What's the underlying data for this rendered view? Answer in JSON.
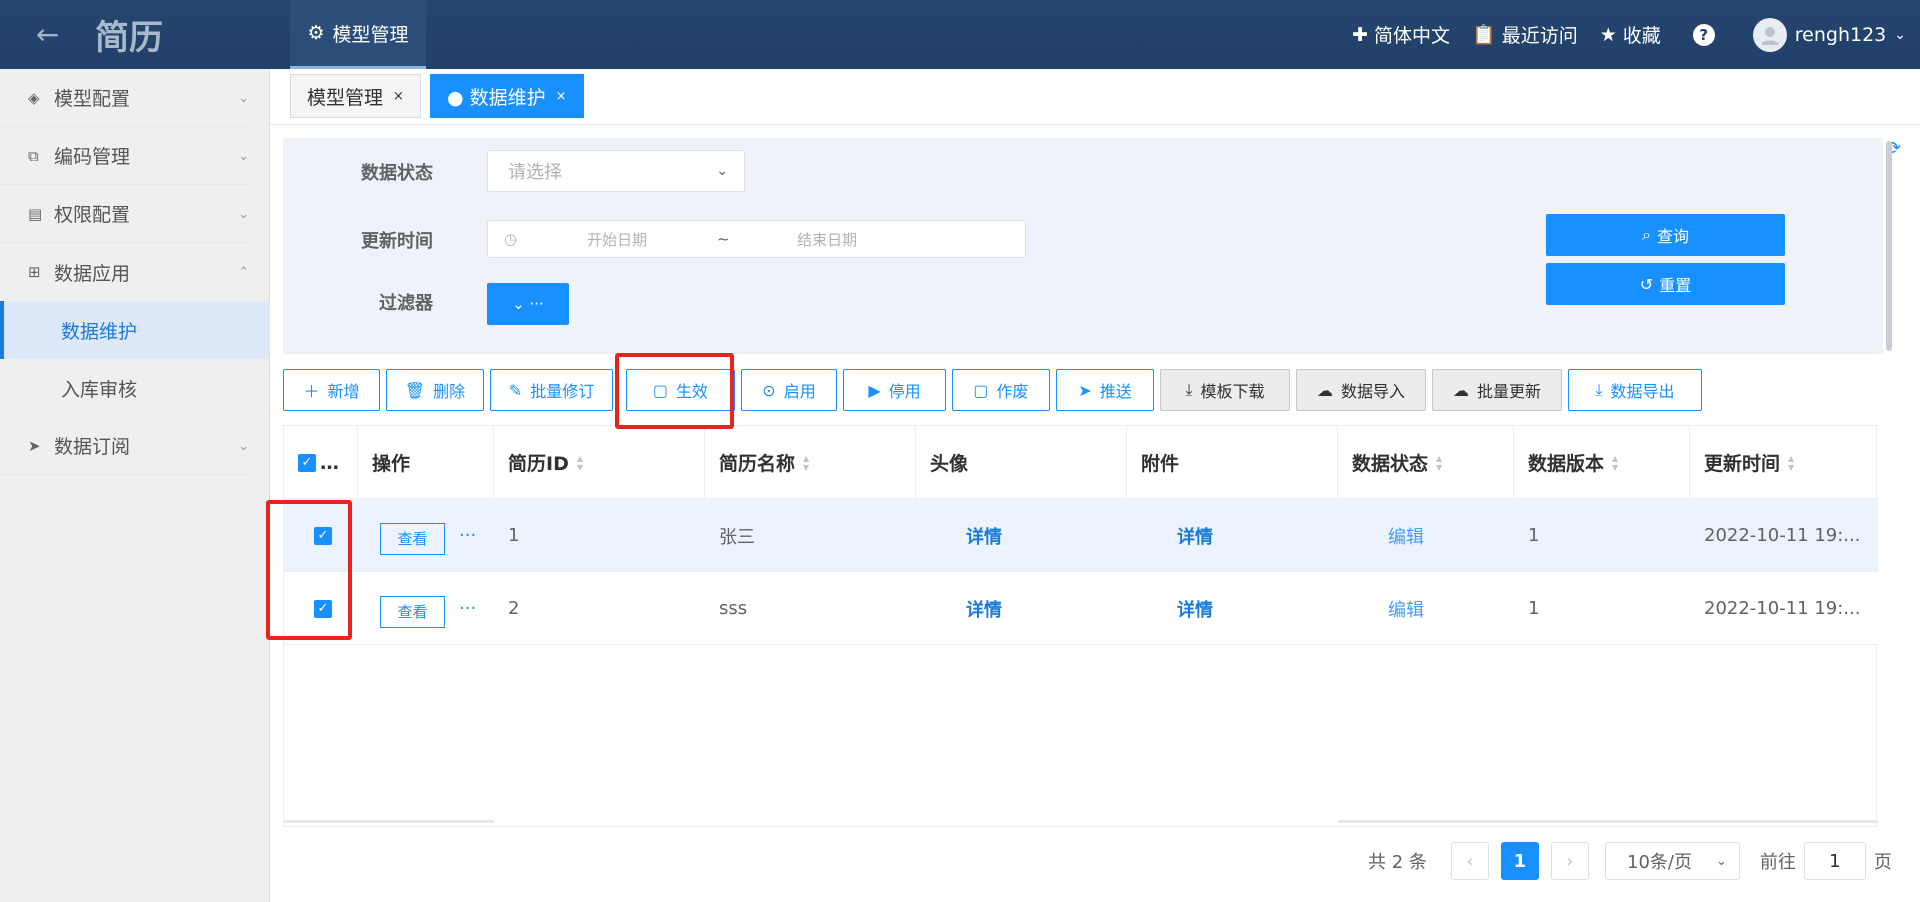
{
  "app": {
    "title": "简历"
  },
  "topnav": {
    "tab": "模型管理",
    "lang": "简体中文",
    "recent": "最近访问",
    "favorite": "收藏",
    "help": "?",
    "user": "rengh123"
  },
  "sidebar": {
    "items": [
      {
        "label": "模型配置",
        "icon": "layers-icon"
      },
      {
        "label": "编码管理",
        "icon": "code-icon"
      },
      {
        "label": "权限配置",
        "icon": "permission-icon"
      },
      {
        "label": "数据应用",
        "icon": "grid-icon"
      }
    ],
    "subitems": [
      {
        "label": "数据维护"
      },
      {
        "label": "入库审核"
      }
    ],
    "last": {
      "label": "数据订阅",
      "icon": "send-icon"
    }
  },
  "tabs": [
    {
      "label": "模型管理",
      "close": "×"
    },
    {
      "label": "● 数据维护",
      "close": "×"
    }
  ],
  "filters": {
    "status_label": "数据状态",
    "status_placeholder": "请选择",
    "time_label": "更新时间",
    "start": "开始日期",
    "tilde": "~",
    "end": "结束日期",
    "filter_label": "过滤器",
    "filter_btn": "⌄ ···",
    "query": "查询",
    "reset": "重置"
  },
  "toolbar": {
    "add": "新增",
    "delete": "删除",
    "batch_edit": "批量修订",
    "effective": "生效",
    "enable": "启用",
    "disable": "停用",
    "void": "作废",
    "push": "推送",
    "template": "模板下载",
    "import": "数据导入",
    "batch_update": "批量更新",
    "export": "数据导出"
  },
  "table": {
    "headers": {
      "select": "…",
      "op": "操作",
      "id": "简历ID",
      "name": "简历名称",
      "avatar": "头像",
      "attach": "附件",
      "status": "数据状态",
      "version": "数据版本",
      "updated": "更新时间"
    },
    "rows": [
      {
        "view": "查看",
        "more": "···",
        "id": "1",
        "name": "张三",
        "avatar": "详情",
        "attach": "详情",
        "status": "编辑",
        "version": "1",
        "updated": "2022-10-11 19:..."
      },
      {
        "view": "查看",
        "more": "···",
        "id": "2",
        "name": "sss",
        "avatar": "详情",
        "attach": "详情",
        "status": "编辑",
        "version": "1",
        "updated": "2022-10-11 19:..."
      }
    ]
  },
  "pagination": {
    "total": "共 2 条",
    "page": "1",
    "size": "10条/页",
    "goto": "前往",
    "goto_val": "1",
    "page_unit": "页"
  }
}
